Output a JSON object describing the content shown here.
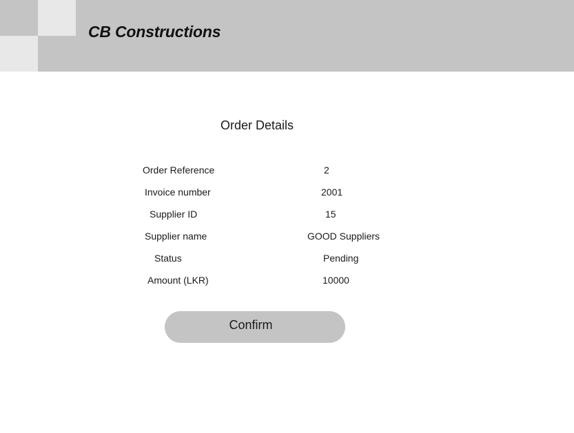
{
  "header": {
    "brand": "CB Constructions"
  },
  "main": {
    "title": "Order Details",
    "fields": [
      {
        "label": "Order Reference",
        "value": "2"
      },
      {
        "label": "Invoice number",
        "value": "2001"
      },
      {
        "label": "Supplier ID",
        "value": "15"
      },
      {
        "label": "Supplier name",
        "value": "GOOD Suppliers"
      },
      {
        "label": "Status",
        "value": "Pending"
      },
      {
        "label": "Amount (LKR)",
        "value": "10000"
      }
    ],
    "confirm_label": "Confirm"
  },
  "colors": {
    "header_bg": "#c4c4c4",
    "logo_square": "#e9e8e9",
    "button_bg": "#c4c4c4"
  }
}
